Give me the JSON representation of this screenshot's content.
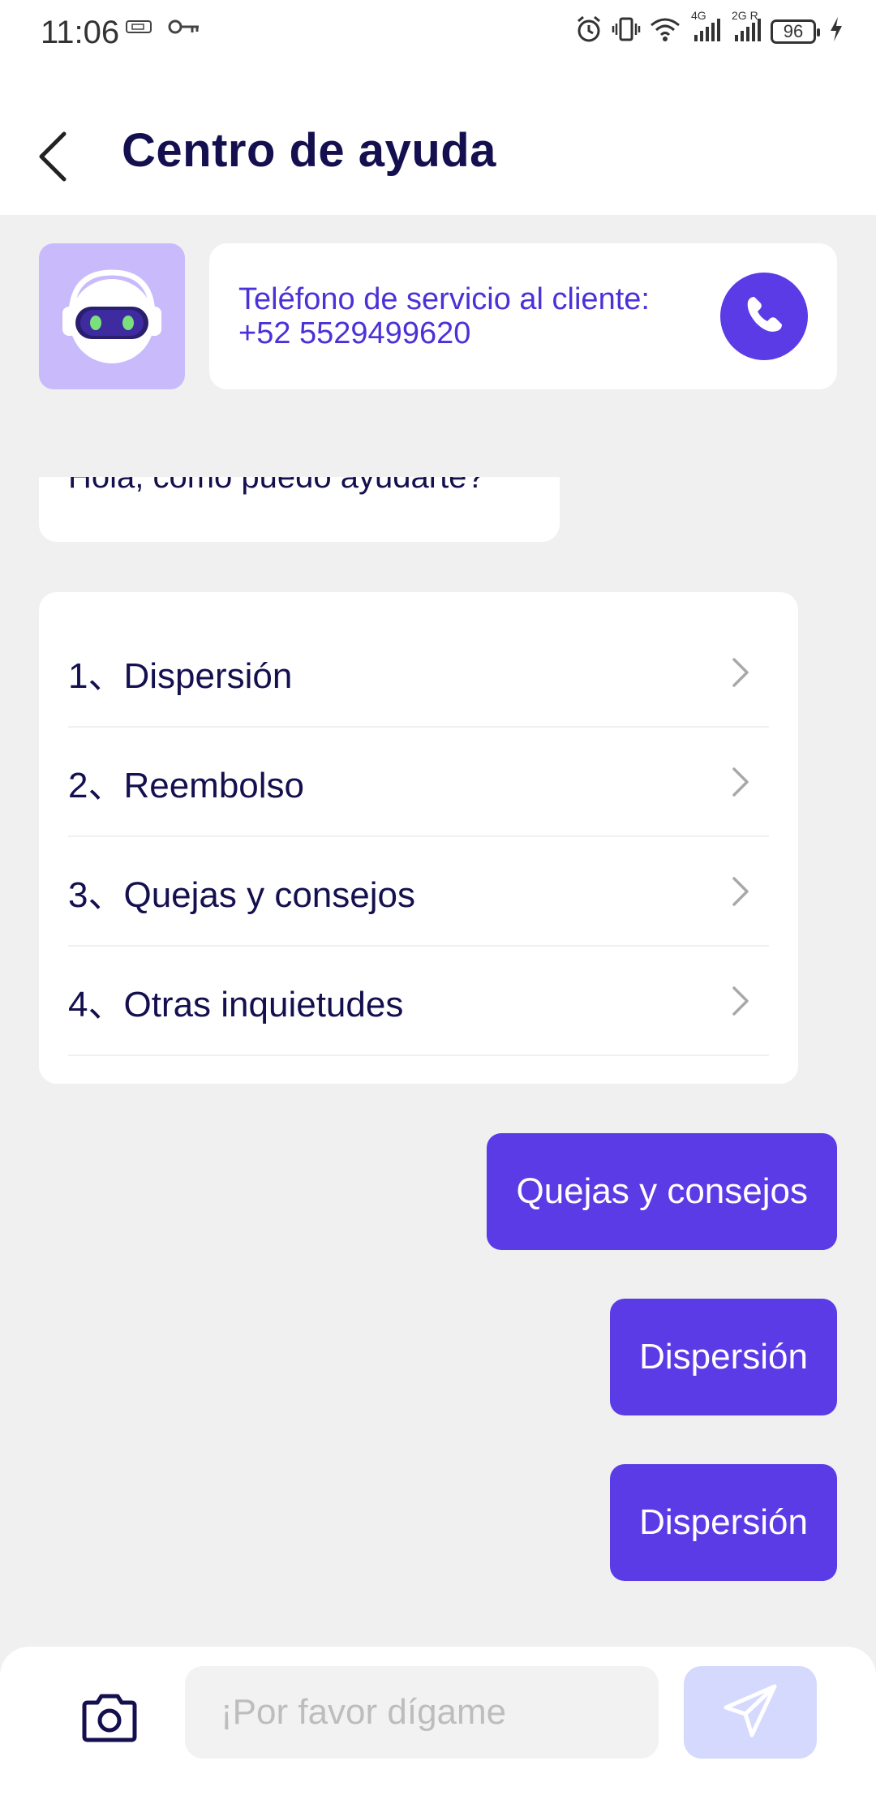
{
  "status_bar": {
    "time": "11:06",
    "battery": "96",
    "network_1": "4G",
    "network_2": "2G R"
  },
  "header": {
    "title": "Centro de ayuda"
  },
  "service": {
    "label": "Teléfono de servicio al cliente:",
    "phone": "+52 5529499620"
  },
  "greeting": {
    "text": "Hola, cómo puedo ayudarte?"
  },
  "menu": {
    "items": [
      {
        "label": "1、Dispersión"
      },
      {
        "label": "2、Reembolso"
      },
      {
        "label": "3、Quejas y consejos"
      },
      {
        "label": "4、Otras inquietudes"
      }
    ]
  },
  "messages": [
    {
      "text": "Quejas y consejos"
    },
    {
      "text": "Dispersión"
    },
    {
      "text": "Dispersión"
    }
  ],
  "composer": {
    "placeholder": "¡Por favor dígame"
  },
  "colors": {
    "accent": "#5B3BE6",
    "title": "#14104F",
    "avatar_bg": "#C9BBFB",
    "send_disabled": "#D5D9FD"
  },
  "icons": {
    "back": "chevron-left-icon",
    "call": "phone-icon",
    "camera": "camera-icon",
    "send": "paper-plane-icon",
    "menu_arrow": "chevron-right-icon"
  }
}
